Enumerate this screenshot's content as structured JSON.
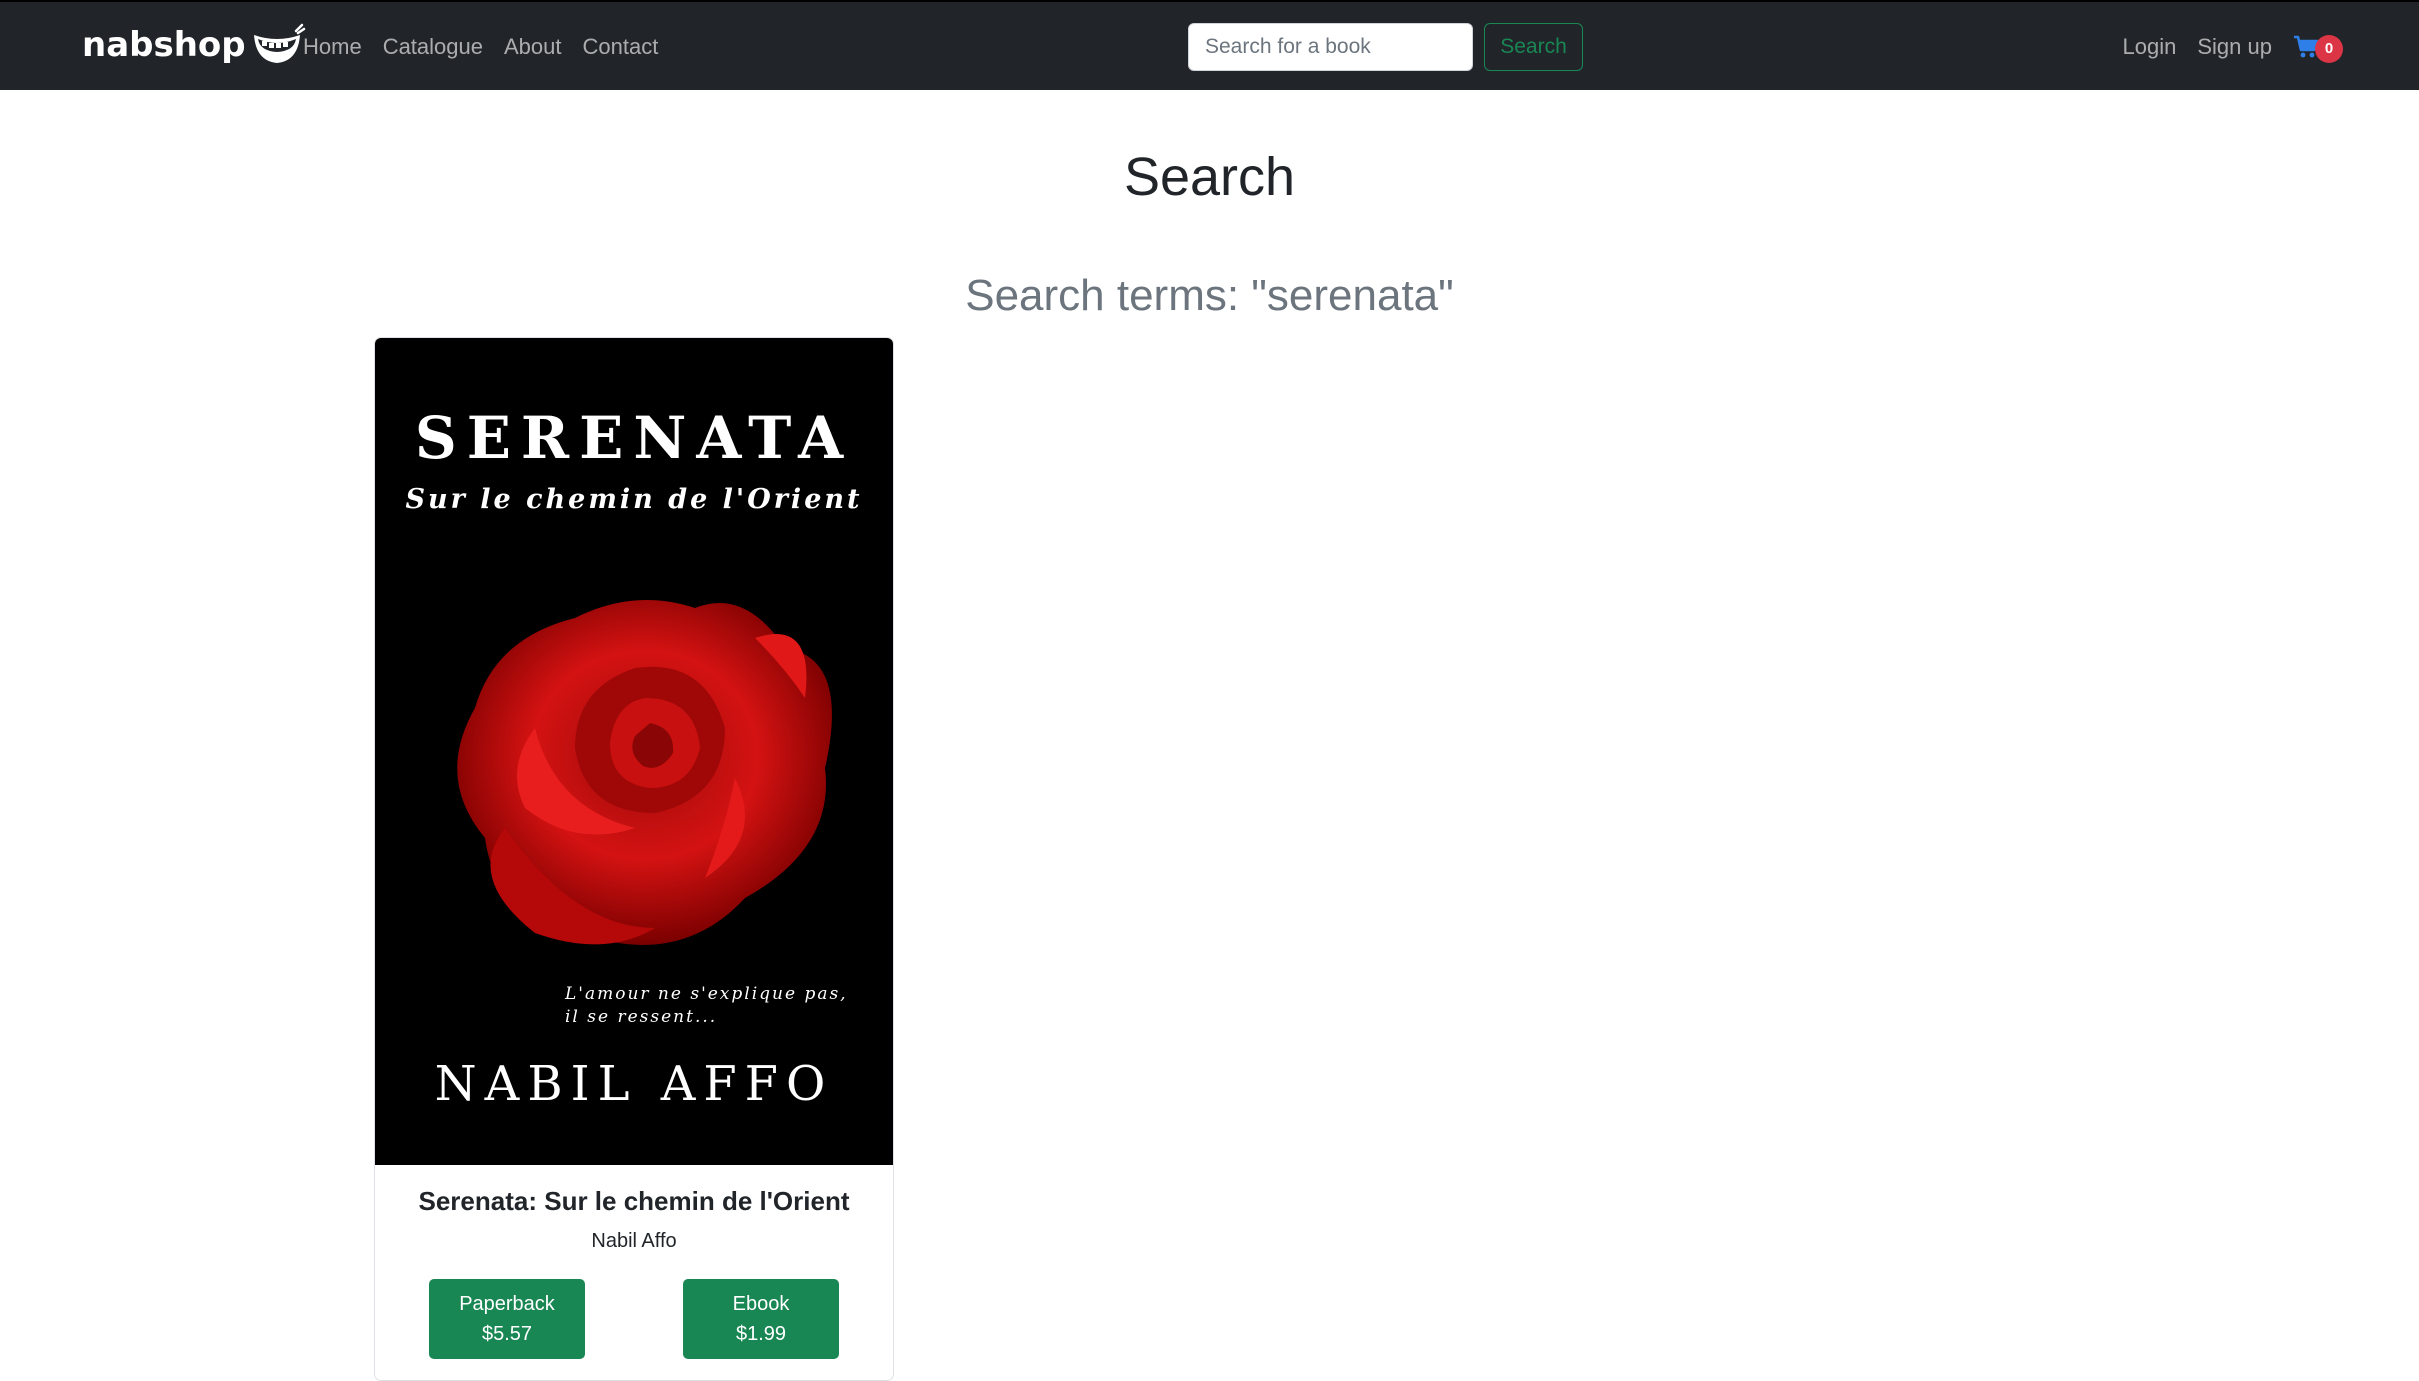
{
  "navbar": {
    "brand": "nabshop",
    "links": [
      "Home",
      "Catalogue",
      "About",
      "Contact"
    ],
    "search_placeholder": "Search for a book",
    "search_button": "Search",
    "login": "Login",
    "signup": "Sign up",
    "cart_count": "0",
    "cart_icon": "shopping-cart-icon"
  },
  "main": {
    "title": "Search",
    "search_terms": "Search terms: \"serenata\""
  },
  "results": [
    {
      "cover": {
        "title": "SERENATA",
        "subtitle": "Sur le chemin de l'Orient",
        "quote_line1": "L'amour ne s'explique pas,",
        "quote_line2": "il se ressent...",
        "author": "NABIL AFFO"
      },
      "title": "Serenata: Sur le chemin de l'Orient",
      "author": "Nabil Affo",
      "formats": [
        {
          "label": "Paperback",
          "price": "$5.57"
        },
        {
          "label": "Ebook",
          "price": "$1.99"
        }
      ]
    }
  ],
  "colors": {
    "navbar_bg": "#212529",
    "success": "#198754",
    "badge": "#dc3545",
    "cart_icon": "#0d6efd"
  }
}
